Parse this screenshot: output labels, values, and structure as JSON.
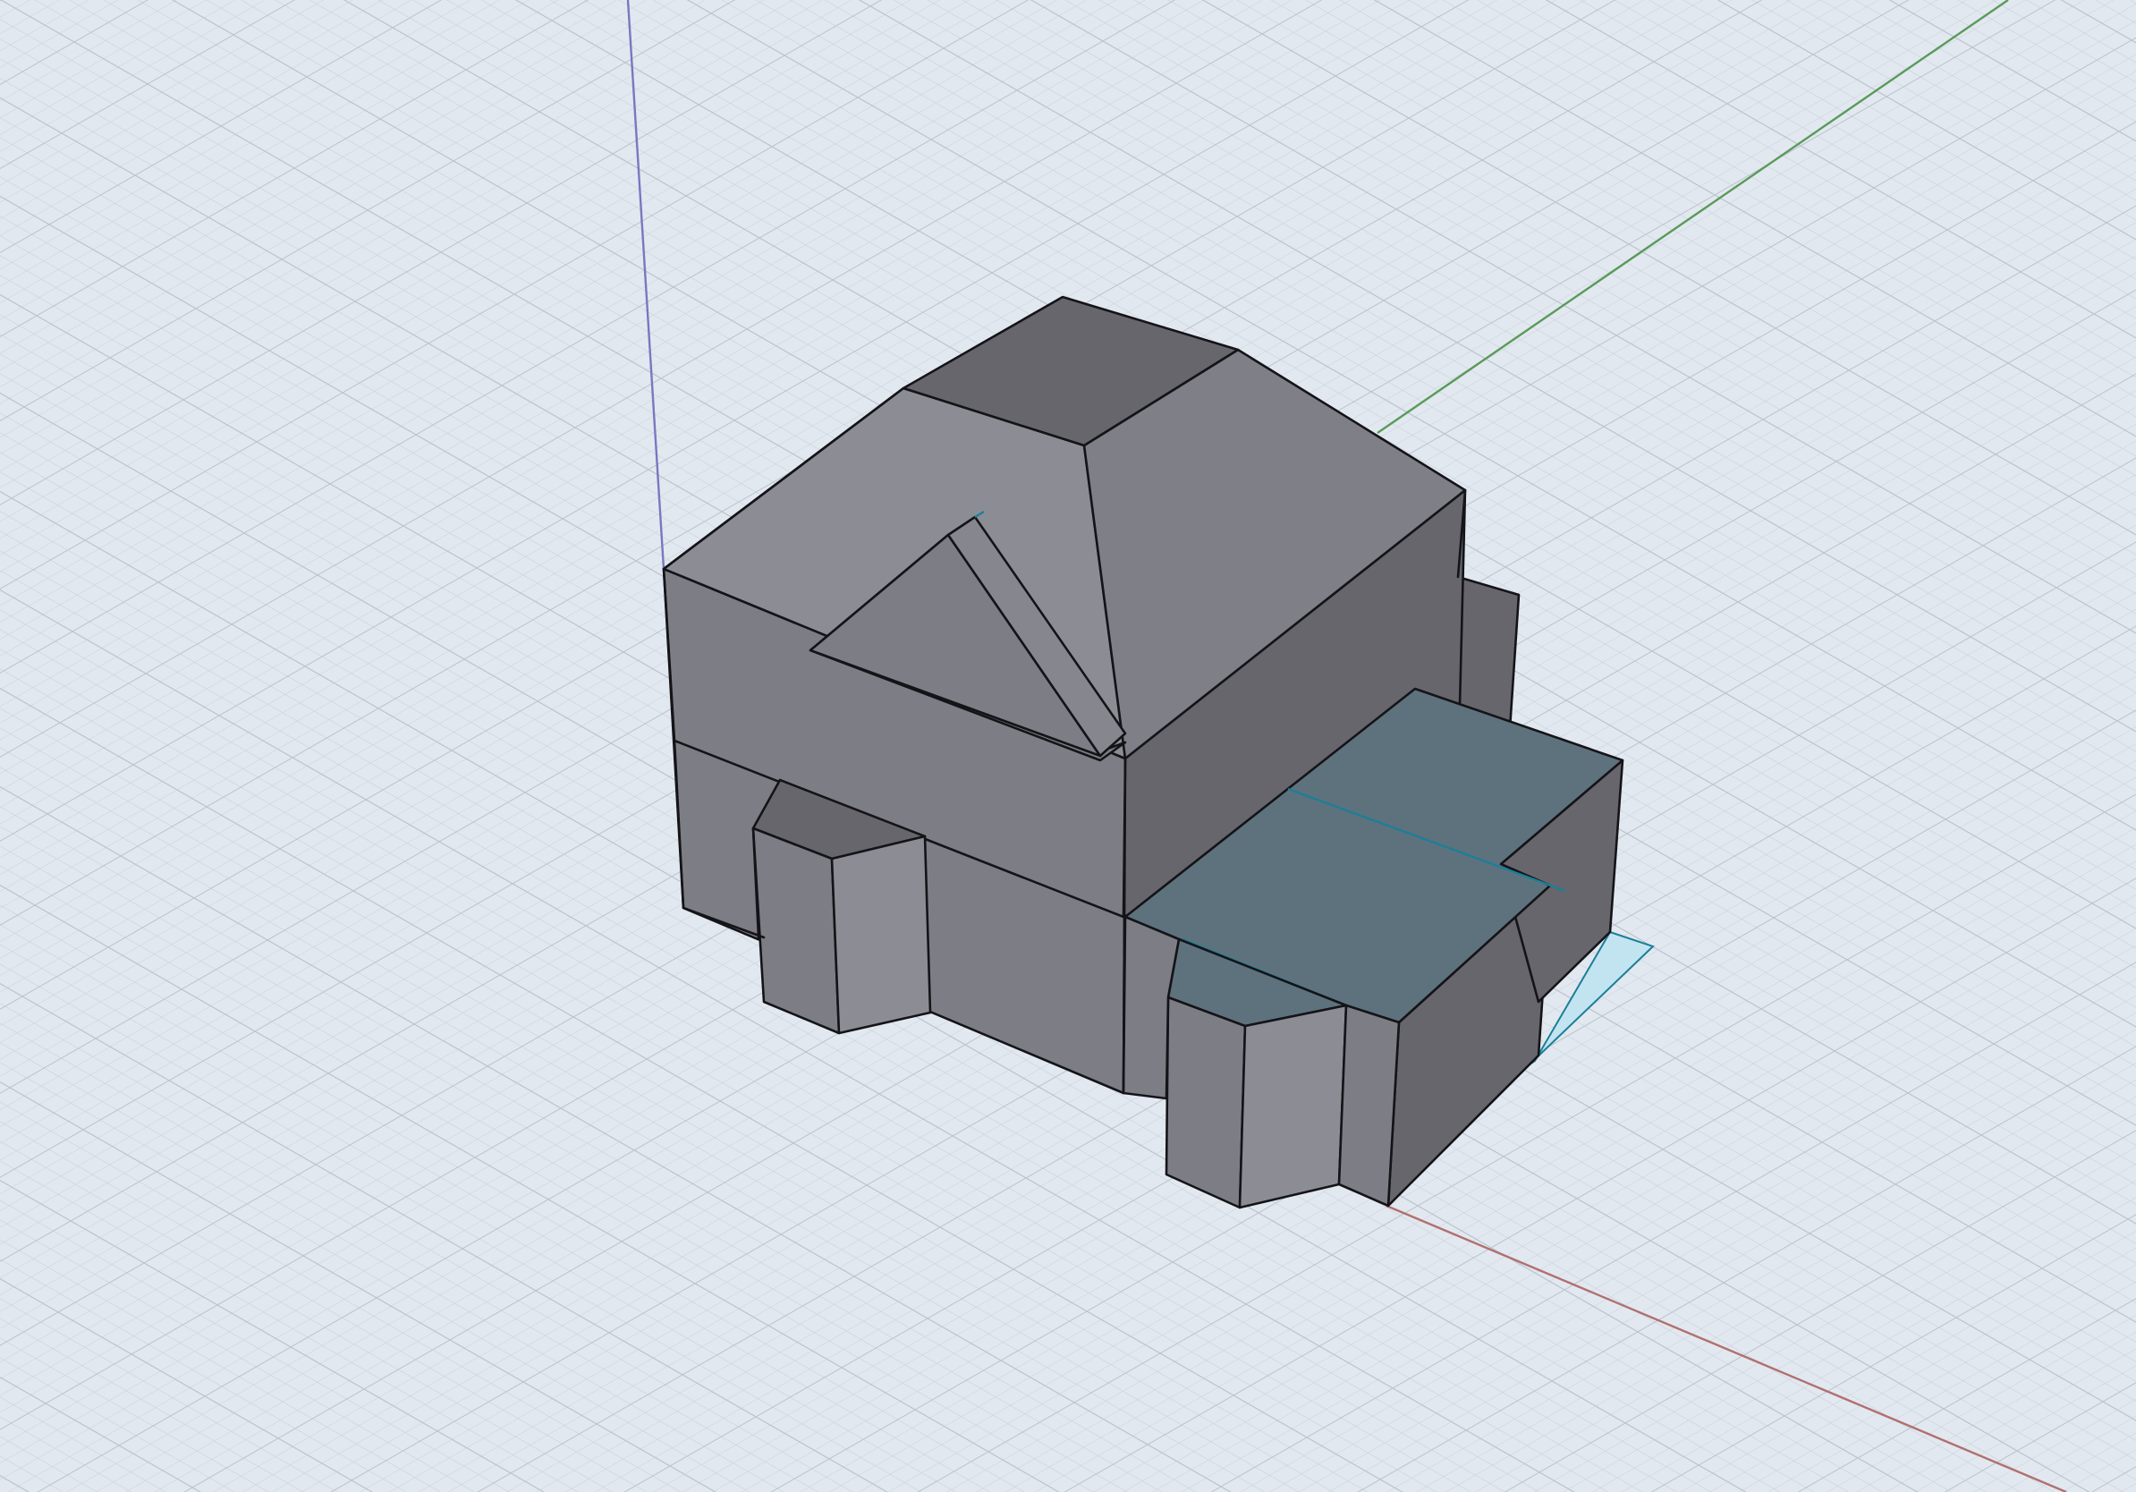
{
  "app": {
    "view": "3d-model-viewport"
  },
  "colors": {
    "background": "#e2e8ef",
    "grid_minor": "#c9d3de",
    "grid_major": "#b9c3ce",
    "axis_x": "#b07070",
    "axis_y": "#5a9a5a",
    "axis_z": "#7878c0",
    "face_light": "#8c8d94",
    "face_mid": "#7d7e85",
    "face_dark": "#66656b",
    "face_roof_top": "#67666c",
    "selected_face": "#5e727d",
    "selection_shadow": "#c2e4f0",
    "edge": "#141418",
    "selection_edge": "#1c7f98"
  },
  "model": {
    "name": "house-model",
    "selection": "garage-roof-face"
  }
}
